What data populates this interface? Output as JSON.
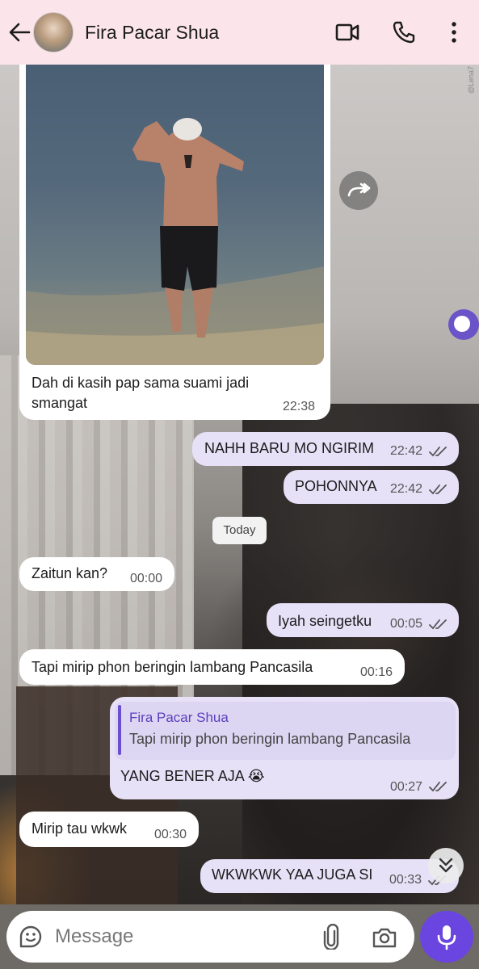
{
  "header": {
    "contact_name": "Fira Pacar Shua",
    "icons": [
      "back-arrow-icon",
      "video-call-icon",
      "phone-icon",
      "more-vert-icon"
    ]
  },
  "watermark": "@Lena7",
  "colors": {
    "header_bg": "#fbe5ea",
    "outgoing_bubble": "#e7e1f8",
    "incoming_bubble": "#ffffff",
    "accent": "#6b45e0"
  },
  "messages": [
    {
      "direction": "in",
      "type": "photo",
      "text": "Dah di kasih pap sama suami jadi smangat",
      "line1": "Dah di kasih pap sama suami jadi",
      "line2": "smangat",
      "time": "22:38"
    },
    {
      "direction": "out",
      "text": "NAHH BARU MO NGIRIM",
      "time": "22:42",
      "status": "read"
    },
    {
      "direction": "out",
      "text": "POHONNYA",
      "time": "22:42",
      "status": "read"
    },
    {
      "type": "date",
      "text": "Today"
    },
    {
      "direction": "in",
      "text": "Zaitun kan?",
      "time": "00:00"
    },
    {
      "direction": "out",
      "text": "Iyah seingetku",
      "time": "00:05",
      "status": "read"
    },
    {
      "direction": "in",
      "text": "Tapi mirip phon beringin lambang Pancasila",
      "time": "00:16"
    },
    {
      "direction": "out",
      "type": "reply",
      "quote_name": "Fira Pacar Shua",
      "quote_text": "Tapi mirip phon beringin lambang Pancasila",
      "text": "YANG BENER AJA 😭",
      "time": "00:27",
      "status": "read"
    },
    {
      "direction": "in",
      "text": "Mirip tau wkwk",
      "time": "00:30"
    },
    {
      "direction": "out",
      "text": "WKWKWK YAA JUGA SI",
      "time": "00:33",
      "status": "read"
    }
  ],
  "composer": {
    "placeholder": "Message",
    "icons": [
      "sticker-emoji-icon",
      "paperclip-icon",
      "camera-icon",
      "microphone-icon"
    ]
  }
}
